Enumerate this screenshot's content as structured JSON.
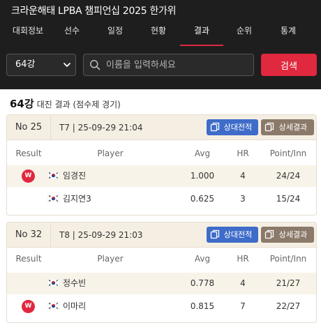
{
  "app": {
    "title": "크라운해태 LPBA 챔피언십 2025 한가위"
  },
  "nav": [
    {
      "label": "대회정보",
      "active": false
    },
    {
      "label": "선수",
      "active": false
    },
    {
      "label": "일정",
      "active": false
    },
    {
      "label": "현황",
      "active": false
    },
    {
      "label": "결과",
      "active": true
    },
    {
      "label": "순위",
      "active": false
    },
    {
      "label": "통계",
      "active": false
    }
  ],
  "filter": {
    "round_value": "64강",
    "search_placeholder": "이름을 입력하세요",
    "search_value": "",
    "search_button": "검색"
  },
  "section": {
    "round": "64강",
    "subtitle": "대진 결과 (점수제 경기)"
  },
  "columns": {
    "result": "Result",
    "player": "Player",
    "avg": "Avg",
    "hr": "HR",
    "point": "Point/Inn"
  },
  "buttons": {
    "head_to_head": "상대전적",
    "detail": "상세결과"
  },
  "win_badge": "W",
  "icons": {
    "round_select": "chevron-down-icon",
    "search": "search-icon",
    "head_to_head": "copy-icon",
    "detail": "copy-icon",
    "flag": "korea-flag-icon"
  },
  "colors": {
    "accent": "#e0283f",
    "header_bg": "#1e1e1e",
    "blue_button": "#3f6cc9",
    "brown_button": "#8b7a6a",
    "card_head_bg": "#f5efe3"
  },
  "matches": [
    {
      "no": "No 25",
      "info": "T7 | 25-09-29 21:04",
      "players": [
        {
          "winner": true,
          "name": "임경진",
          "avg": "1.000",
          "hr": "4",
          "point_inn": "24/24"
        },
        {
          "winner": false,
          "name": "김지연3",
          "avg": "0.625",
          "hr": "3",
          "point_inn": "15/24"
        }
      ]
    },
    {
      "no": "No 32",
      "info": "T8 | 25-09-29 21:03",
      "players": [
        {
          "winner": false,
          "name": "정수빈",
          "avg": "0.778",
          "hr": "4",
          "point_inn": "21/27"
        },
        {
          "winner": true,
          "name": "이마리",
          "avg": "0.815",
          "hr": "7",
          "point_inn": "22/27"
        }
      ]
    }
  ]
}
